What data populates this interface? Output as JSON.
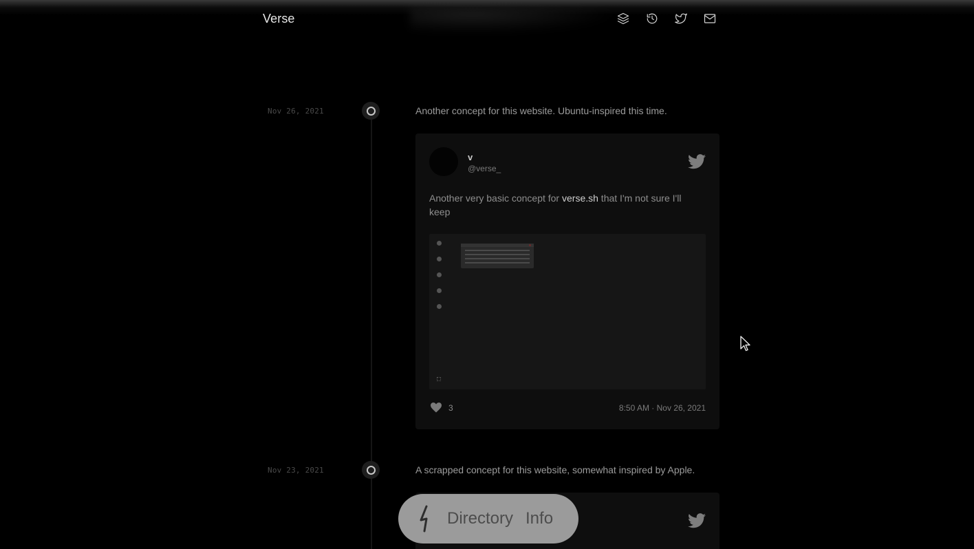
{
  "header": {
    "brand": "Verse",
    "icons": [
      "layers-icon",
      "history-icon",
      "twitter-icon",
      "mail-icon"
    ]
  },
  "timeline": [
    {
      "date": "Nov 26, 2021",
      "text": "Another concept for this website. Ubuntu-inspired this time.",
      "tweet": {
        "author_name": "v",
        "author_handle": "@verse_",
        "body_before": "Another very basic concept for ",
        "body_link": "verse.sh",
        "body_after": " that I'm not sure I'll keep",
        "likes": "3",
        "timestamp": "8:50 AM · Nov 26, 2021"
      }
    },
    {
      "date": "Nov 23, 2021",
      "text": "A scrapped concept for this website, somewhat inspired by Apple."
    }
  ],
  "dock": {
    "directory_label": "Directory",
    "info_label": "Info"
  },
  "colors": {
    "background": "#000000",
    "card": "#0e0e0e",
    "dock": "#9b9b9b",
    "brand_text": "#e8e8e8"
  }
}
